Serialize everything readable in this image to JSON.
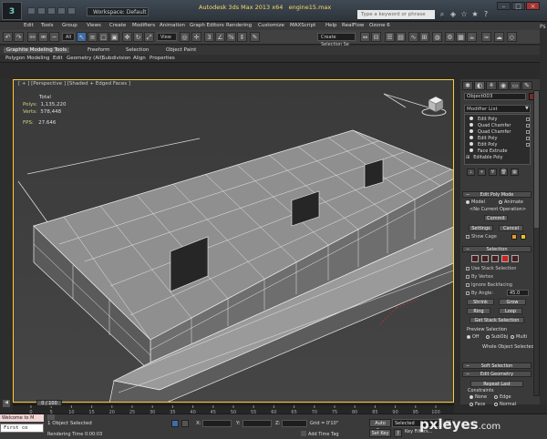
{
  "titlebar": {
    "workspace": "Workspace: Default",
    "app_title": "Autodesk 3ds Max 2013 x64",
    "file": "engine15.max",
    "search_placeholder": "Type a keyword or phrase"
  },
  "menu": [
    "Edit",
    "Tools",
    "Group",
    "Views",
    "Create",
    "Modifiers",
    "Animation",
    "Graph Editors",
    "Rendering",
    "Customize",
    "MAXScript",
    "Help",
    "RealFlow",
    "Ozone 6"
  ],
  "toolbar": {
    "all_filter": "All",
    "view_ref": "View",
    "selection_set": "Create Selection Se"
  },
  "ribbon": {
    "tabs": [
      "Graphite Modeling Tools",
      "Freeform",
      "Selection",
      "Object Paint"
    ],
    "sub": [
      "Polygon Modeling",
      "Edit",
      "Geometry (All)",
      "Subdivision",
      "Align",
      "Properties"
    ]
  },
  "viewport": {
    "label": "[ + ] [Perspective ] [Shaded + Edged Faces ]",
    "stats": {
      "total_label": "Total",
      "polys_label": "Polys:",
      "polys": "1,135,220",
      "verts_label": "Verts:",
      "verts": "578,448",
      "fps_label": "FPS:",
      "fps": "27.646"
    }
  },
  "command_panel": {
    "object_name": "Object003",
    "modifier_list": "Modifier List",
    "stack": [
      "Edit Poly",
      "Quad Chamfer",
      "Quad Chamfer",
      "Edit Poly",
      "Edit Poly",
      "Face Extrude",
      "Editable Poly"
    ],
    "edit_poly_mode": {
      "title": "Edit Poly Mode",
      "model": "Model",
      "animate": "Animate",
      "no_op": "<No Current Operation>",
      "commit": "Commit",
      "settings": "Settings",
      "cancel": "Cancel",
      "show_cage": "Show Cage"
    },
    "selection": {
      "title": "Selection",
      "use_stack": "Use Stack Selection",
      "by_vertex": "By Vertex",
      "ignore_backfacing": "Ignore Backfacing",
      "by_angle": "By Angle:",
      "angle_value": "45.0",
      "shrink": "Shrink",
      "grow": "Grow",
      "ring": "Ring",
      "loop": "Loop",
      "get_stack": "Get Stack Selection",
      "preview": "Preview Selection",
      "off": "Off",
      "subobj": "SubObj",
      "multi": "Multi",
      "whole_selected": "Whole Object Selected"
    },
    "soft_selection": "Soft Selection",
    "edit_geometry": {
      "title": "Edit Geometry",
      "repeat_last": "Repeat Last",
      "constraints": "Constraints",
      "none": "None",
      "edge": "Edge",
      "face": "Face",
      "normal": "Normal"
    }
  },
  "timeline": {
    "slider": "0 / 100",
    "ticks": [
      "0",
      "5",
      "10",
      "15",
      "20",
      "25",
      "30",
      "35",
      "40",
      "45",
      "50",
      "55",
      "60",
      "65",
      "70",
      "75",
      "80",
      "85",
      "90",
      "95",
      "100"
    ]
  },
  "status": {
    "maxscript": "Welcome to M",
    "maxscript_input": "First co",
    "selected_count": "1 Object Selected",
    "rendering_time": "Rendering Time 0:00:03",
    "x_label": "X:",
    "y_label": "Y:",
    "z_label": "Z:",
    "grid": "Grid = 0'10\"",
    "add_time_tag": "Add Time Tag",
    "auto_key": "Auto Key",
    "set_key": "Set Key",
    "selected_dropdown": "Selected",
    "key_filters": "Key Filters..."
  },
  "watermark": {
    "brand": "pxleyes",
    "domain": ".com"
  },
  "colors": {
    "viewport_bg": "#414141",
    "viewport_border": "#ffcc33",
    "active_tool": "#3e6ea8",
    "stats_label": "#d4d48a"
  }
}
